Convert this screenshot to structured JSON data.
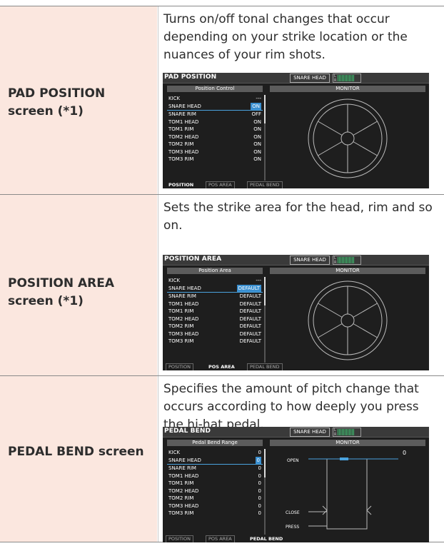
{
  "rows": [
    {
      "label": "PAD POSITION screen (*1)",
      "label_lines": [
        "PAD POSITION",
        "screen (*1)"
      ],
      "desc_lines": [
        "Turns on/off tonal changes that occur",
        "depending on your strike location or the",
        "nuances of your rim shots."
      ],
      "screen": {
        "title": "PAD POSITION",
        "instrument": "SNARE HEAD",
        "meter_labels": [
          "L",
          "R"
        ],
        "left_header": "Position Control",
        "right_header": "MONITOR",
        "items": [
          {
            "name": "KICK",
            "value": "---"
          },
          {
            "name": "SNARE HEAD",
            "value": "ON",
            "selected": true
          },
          {
            "name": "SNARE RIM",
            "value": "OFF"
          },
          {
            "name": "TOM1 HEAD",
            "value": "ON"
          },
          {
            "name": "TOM1 RIM",
            "value": "ON"
          },
          {
            "name": "TOM2 HEAD",
            "value": "ON"
          },
          {
            "name": "TOM2 RIM",
            "value": "ON"
          },
          {
            "name": "TOM3 HEAD",
            "value": "ON"
          },
          {
            "name": "TOM3 RIM",
            "value": "ON"
          }
        ],
        "tabs": [
          "POSITION",
          "POS AREA",
          "PEDAL BEND"
        ],
        "active_tab": 0,
        "monitor": "pad"
      }
    },
    {
      "label": "POSITION AREA screen (*1)",
      "label_lines": [
        "POSITION AREA",
        "screen (*1)"
      ],
      "desc_lines": [
        "Sets the strike area for the head, rim and so",
        "on."
      ],
      "screen": {
        "title": "POSITION AREA",
        "instrument": "SNARE HEAD",
        "meter_labels": [
          "L",
          "R"
        ],
        "left_header": "Position Area",
        "right_header": "MONITOR",
        "items": [
          {
            "name": "KICK",
            "value": "---"
          },
          {
            "name": "SNARE HEAD",
            "value": "DEFAULT",
            "selected": true
          },
          {
            "name": "SNARE RIM",
            "value": "DEFAULT"
          },
          {
            "name": "TOM1 HEAD",
            "value": "DEFAULT"
          },
          {
            "name": "TOM1 RIM",
            "value": "DEFAULT"
          },
          {
            "name": "TOM2 HEAD",
            "value": "DEFAULT"
          },
          {
            "name": "TOM2 RIM",
            "value": "DEFAULT"
          },
          {
            "name": "TOM3 HEAD",
            "value": "DEFAULT"
          },
          {
            "name": "TOM3 RIM",
            "value": "DEFAULT"
          }
        ],
        "tabs": [
          "POSITION",
          "POS AREA",
          "PEDAL BEND"
        ],
        "active_tab": 1,
        "monitor": "pad"
      }
    },
    {
      "label": "PEDAL BEND screen",
      "label_lines": [
        "PEDAL BEND screen"
      ],
      "desc_lines": [
        "Specifies the amount of pitch change that",
        "occurs according to how deeply you press",
        "the hi-hat pedal."
      ],
      "screen": {
        "title": "PEDAL BEND",
        "instrument": "SNARE HEAD",
        "meter_labels": [
          "L",
          "R"
        ],
        "left_header": "Pedal Bend Range",
        "right_header": "MONITOR",
        "items": [
          {
            "name": "KICK",
            "value": "0"
          },
          {
            "name": "SNARE HEAD",
            "value": "0",
            "selected": true
          },
          {
            "name": "SNARE RIM",
            "value": "0"
          },
          {
            "name": "TOM1 HEAD",
            "value": "0"
          },
          {
            "name": "TOM1 RIM",
            "value": "0"
          },
          {
            "name": "TOM2 HEAD",
            "value": "0"
          },
          {
            "name": "TOM2 RIM",
            "value": "0"
          },
          {
            "name": "TOM3 HEAD",
            "value": "0"
          },
          {
            "name": "TOM3 RIM",
            "value": "0"
          }
        ],
        "tabs": [
          "POSITION",
          "POS AREA",
          "PEDAL BEND"
        ],
        "active_tab": 2,
        "monitor": "pedal",
        "pedal": {
          "value": "0",
          "open": "OPEN",
          "close": "CLOSE",
          "press": "PRESS"
        }
      }
    }
  ],
  "colors": {
    "left_bg": "#fbe7df",
    "screen_bg": "#1e1e1e",
    "accent": "#3a8fd0"
  }
}
